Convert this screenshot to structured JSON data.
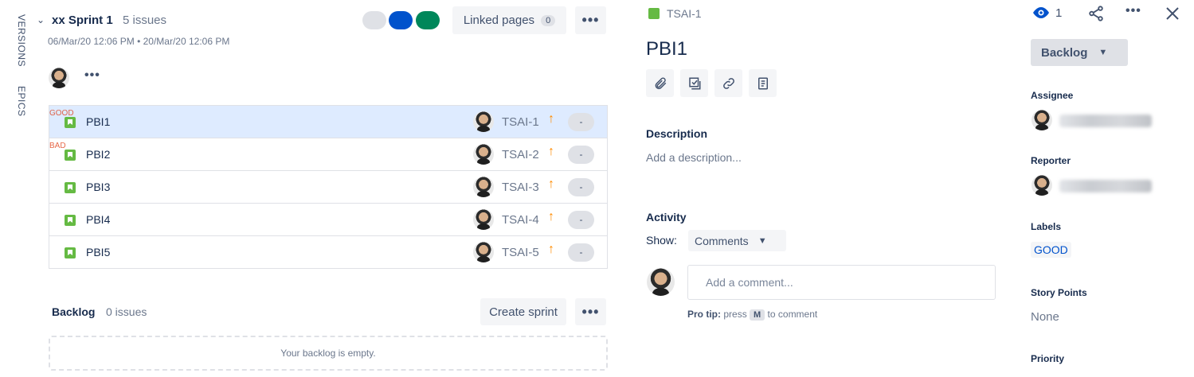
{
  "sidebar": {
    "versions_label": "VERSIONS",
    "epics_label": "EPICS"
  },
  "sprint": {
    "name": "xx Sprint 1",
    "issue_count": "5 issues",
    "start_date": "06/Mar/20 12:06 PM",
    "date_separator": "•",
    "end_date": "20/Mar/20 12:06 PM",
    "status_colors": [
      "#dfe1e6",
      "#0052cc",
      "#00875a"
    ],
    "linked_pages_label": "Linked pages",
    "linked_pages_count": "0",
    "more_label": "•••"
  },
  "issues": [
    {
      "title": "PBI1",
      "key": "TSAI-1",
      "priority": "↑",
      "estimate": "-",
      "label": "GOOD"
    },
    {
      "title": "PBI2",
      "key": "TSAI-2",
      "priority": "↑",
      "estimate": "-",
      "label": "BAD"
    },
    {
      "title": "PBI3",
      "key": "TSAI-3",
      "priority": "↑",
      "estimate": "-"
    },
    {
      "title": "PBI4",
      "key": "TSAI-4",
      "priority": "↑",
      "estimate": "-"
    },
    {
      "title": "PBI5",
      "key": "TSAI-5",
      "priority": "↑",
      "estimate": "-"
    }
  ],
  "backlog": {
    "name": "Backlog",
    "issue_count": "0 issues",
    "create_sprint_label": "Create sprint",
    "more_label": "•••",
    "empty_message": "Your backlog is empty."
  },
  "detail": {
    "issue_key": "TSAI-1",
    "title": "PBI1",
    "watch_count": "1",
    "status": "Backlog",
    "description_heading": "Description",
    "description_placeholder": "Add a description...",
    "activity_heading": "Activity",
    "show_label": "Show:",
    "show_value": "Comments",
    "comment_placeholder": "Add a comment...",
    "pro_tip_bold": "Pro tip:",
    "pro_tip_press": "press",
    "pro_tip_key": "M",
    "pro_tip_rest": "to comment",
    "fields": {
      "assignee_label": "Assignee",
      "reporter_label": "Reporter",
      "labels_label": "Labels",
      "label_value": "GOOD",
      "story_points_label": "Story Points",
      "story_points_value": "None",
      "priority_label": "Priority"
    }
  }
}
